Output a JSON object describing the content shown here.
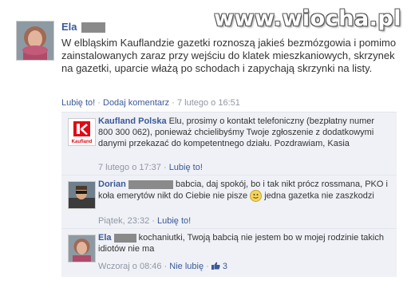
{
  "watermark": {
    "text": "www.wiocha.pl",
    "brand_color": "#d21a1a"
  },
  "post": {
    "author": "Ela",
    "text": "W elbląskim Kauflandzie gazetki roznoszą jakieś bezmózgowia i pomimo zainstalowanych zaraz przy wejściu do klatek mieszkaniowych, skrzynek na gazetki, uparcie włażą po schodach i zapychają skrzynki na listy.",
    "like_label": "Lubię to!",
    "comment_label": "Dodaj komentarz",
    "time": "7 lutego o 16:51"
  },
  "comments": [
    {
      "author": "Kaufland Polska",
      "text": "Elu, prosimy o kontakt telefoniczny (bezpłatny numer 800 300 062), ponieważ chcielibyśmy Twoje zgłoszenie z dodatkowymi danymi przekazać do kompetentnego działu. Pozdrawiam, Kasia",
      "time": "7 lutego o 17:37",
      "like_label": "Lubię to!",
      "logo_text": "Kaufland",
      "logo_color": "#e10915"
    },
    {
      "author": "Dorian",
      "text_before": "babcia, daj spokój, bo i tak nikt prócz rossmana, PKO i koła emerytów nikt do Ciebie nie pisze",
      "text_after": "jedna gazetka nie zaszkodzi",
      "time": "Piątek, 23:32",
      "like_label": "Lubię to!"
    },
    {
      "author": "Ela",
      "text": "kochaniutki, Twoją babcią nie jestem bo w mojej rodzinie takich idiotów nie ma",
      "time": "Wczoraj o 08:46",
      "like_label": "Nie lubię",
      "likes": "3"
    }
  ],
  "colors": {
    "link": "#3b5998",
    "meta": "#9197a3",
    "comment_bg": "#eff1f6"
  }
}
